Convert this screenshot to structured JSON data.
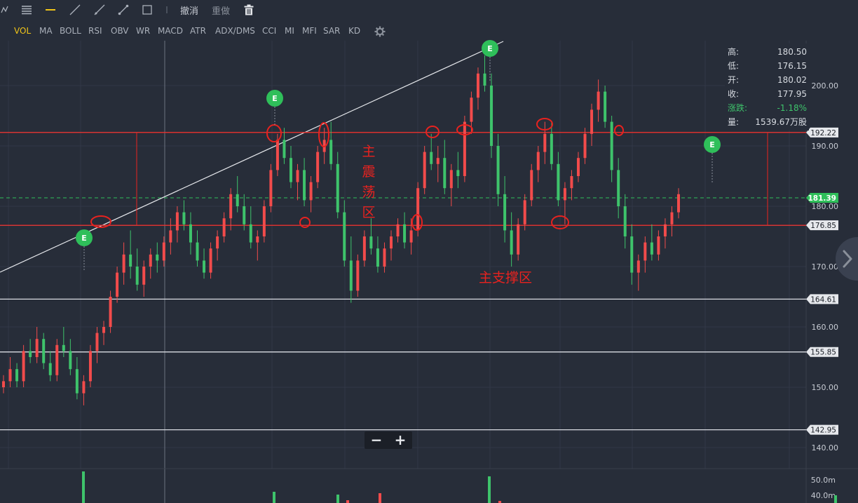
{
  "toolbar": {
    "undo_label": "撤消",
    "redo_label": "重做"
  },
  "indicators": [
    "VOL",
    "MA",
    "BOLL",
    "RSI",
    "OBV",
    "WR",
    "MACD",
    "ATR",
    "ADX/DMS",
    "CCI",
    "MI",
    "MFI",
    "SAR",
    "KD"
  ],
  "active_indicator": "VOL",
  "ohlc_panel": {
    "rows": [
      {
        "key": "高:",
        "value": "180.50"
      },
      {
        "key": "低:",
        "value": "176.15"
      },
      {
        "key": "开:",
        "value": "180.02"
      },
      {
        "key": "收:",
        "value": "177.95"
      },
      {
        "key": "涨跌:",
        "value": "-1.18%"
      },
      {
        "key": "量:",
        "value": "1539.67万股"
      }
    ],
    "change_color": "#3ec36b"
  },
  "zoom": {
    "minus": "−",
    "plus": "+"
  },
  "colors": {
    "background": "#272d39",
    "up": "#f24b4b",
    "down": "#3ec36b",
    "annotation": "#e8221f",
    "level_line": "#d9dce2",
    "current_price": "#2fbf5a"
  },
  "chart_data": {
    "type": "candlestick",
    "ylim": [
      135,
      208
    ],
    "y_ticks": [
      140,
      150,
      160,
      170,
      180,
      190,
      200
    ],
    "y_tick_labels": [
      "140.00",
      "150.00",
      "160.00",
      "170.00",
      "180.00",
      "190.00",
      "200.00"
    ],
    "horizontal_levels": [
      {
        "value": 192.22,
        "label": "192.22",
        "color": "#d9dce2"
      },
      {
        "value": 176.85,
        "label": "176.85",
        "color": "#d9dce2"
      },
      {
        "value": 164.61,
        "label": "164.61",
        "color": "#d9dce2"
      },
      {
        "value": 155.85,
        "label": "155.85",
        "color": "#d9dce2"
      },
      {
        "value": 142.95,
        "label": "142.95",
        "color": "#d9dce2"
      }
    ],
    "current_price": {
      "value": 181.39,
      "label": "181.39"
    },
    "candles": [
      [
        150,
        152,
        149,
        151
      ],
      [
        151,
        155,
        150,
        153
      ],
      [
        153,
        154,
        150,
        151
      ],
      [
        151,
        157,
        150,
        156
      ],
      [
        156,
        158,
        154,
        155
      ],
      [
        155,
        160,
        154,
        158
      ],
      [
        158,
        159,
        153,
        154
      ],
      [
        154,
        156,
        151,
        152
      ],
      [
        152,
        158,
        151,
        157
      ],
      [
        157,
        160,
        155,
        156
      ],
      [
        156,
        158,
        152,
        153
      ],
      [
        153,
        155,
        148,
        149
      ],
      [
        149,
        152,
        147,
        151
      ],
      [
        151,
        157,
        150,
        156
      ],
      [
        156,
        160,
        154,
        159
      ],
      [
        159,
        161,
        157,
        160
      ],
      [
        160,
        166,
        159,
        165
      ],
      [
        165,
        170,
        164,
        169
      ],
      [
        169,
        174,
        167,
        172
      ],
      [
        172,
        176,
        168,
        170
      ],
      [
        170,
        173,
        166,
        167
      ],
      [
        167,
        171,
        165,
        170
      ],
      [
        170,
        173,
        168,
        172
      ],
      [
        172,
        174,
        169,
        171
      ],
      [
        171,
        175,
        170,
        174
      ],
      [
        174,
        178,
        172,
        176
      ],
      [
        176,
        180,
        174,
        179
      ],
      [
        179,
        181,
        176,
        177
      ],
      [
        177,
        179,
        172,
        174
      ],
      [
        174,
        176,
        170,
        171
      ],
      [
        171,
        173,
        168,
        169
      ],
      [
        169,
        174,
        168,
        173
      ],
      [
        173,
        176,
        171,
        175
      ],
      [
        175,
        179,
        174,
        178
      ],
      [
        178,
        183,
        176,
        182
      ],
      [
        182,
        185,
        179,
        180
      ],
      [
        180,
        182,
        176,
        177
      ],
      [
        177,
        180,
        173,
        174
      ],
      [
        174,
        176,
        171,
        175
      ],
      [
        175,
        181,
        174,
        180
      ],
      [
        180,
        187,
        179,
        186
      ],
      [
        186,
        192,
        185,
        191
      ],
      [
        191,
        193,
        187,
        188
      ],
      [
        188,
        190,
        183,
        184
      ],
      [
        184,
        187,
        181,
        186
      ],
      [
        186,
        188,
        180,
        181
      ],
      [
        181,
        185,
        179,
        184
      ],
      [
        184,
        190,
        183,
        189
      ],
      [
        189,
        193,
        187,
        191
      ],
      [
        191,
        194,
        186,
        187
      ],
      [
        187,
        189,
        178,
        179
      ],
      [
        179,
        181,
        170,
        171
      ],
      [
        171,
        175,
        164,
        166
      ],
      [
        166,
        172,
        165,
        171
      ],
      [
        171,
        176,
        170,
        175
      ],
      [
        175,
        178,
        172,
        173
      ],
      [
        173,
        175,
        169,
        170
      ],
      [
        170,
        174,
        169,
        173
      ],
      [
        173,
        176,
        171,
        175
      ],
      [
        175,
        178,
        174,
        177
      ],
      [
        177,
        179,
        173,
        174
      ],
      [
        174,
        178,
        172,
        176
      ],
      [
        176,
        184,
        175,
        183
      ],
      [
        183,
        190,
        182,
        189
      ],
      [
        189,
        192,
        186,
        187
      ],
      [
        187,
        190,
        184,
        188
      ],
      [
        188,
        191,
        182,
        183
      ],
      [
        183,
        187,
        180,
        186
      ],
      [
        186,
        189,
        183,
        185
      ],
      [
        185,
        195,
        184,
        194
      ],
      [
        194,
        199,
        192,
        198
      ],
      [
        198,
        203,
        196,
        202
      ],
      [
        202,
        205,
        199,
        200
      ],
      [
        200,
        202,
        188,
        190
      ],
      [
        190,
        192,
        180,
        182
      ],
      [
        182,
        185,
        174,
        176
      ],
      [
        176,
        179,
        170,
        172
      ],
      [
        172,
        178,
        171,
        177
      ],
      [
        177,
        182,
        176,
        181
      ],
      [
        181,
        187,
        180,
        186
      ],
      [
        186,
        190,
        184,
        189
      ],
      [
        189,
        194,
        187,
        192
      ],
      [
        192,
        194,
        186,
        187
      ],
      [
        187,
        189,
        180,
        181
      ],
      [
        181,
        184,
        177,
        183
      ],
      [
        183,
        186,
        181,
        185
      ],
      [
        185,
        189,
        184,
        188
      ],
      [
        188,
        193,
        187,
        192
      ],
      [
        192,
        197,
        190,
        196
      ],
      [
        196,
        201,
        194,
        199
      ],
      [
        199,
        200,
        193,
        194
      ],
      [
        194,
        195,
        184,
        186
      ],
      [
        186,
        188,
        178,
        180
      ],
      [
        180,
        182,
        173,
        175
      ],
      [
        175,
        177,
        167,
        169
      ],
      [
        169,
        172,
        166,
        171
      ],
      [
        171,
        175,
        169,
        174
      ],
      [
        174,
        177,
        171,
        172
      ],
      [
        172,
        176,
        171,
        175
      ],
      [
        175,
        178,
        173,
        177
      ],
      [
        177,
        180,
        175,
        179
      ],
      [
        179,
        183,
        178,
        182
      ]
    ],
    "volume_ticks": [
      {
        "value": 50,
        "label": "50.0m"
      },
      {
        "value": 40,
        "label": "40.0m"
      }
    ],
    "volumes": [
      {
        "x": 119,
        "h": 45,
        "dir": "down"
      },
      {
        "x": 391,
        "h": 16,
        "dir": "down"
      },
      {
        "x": 482,
        "h": 12,
        "dir": "down"
      },
      {
        "x": 496,
        "h": 4,
        "dir": "up"
      },
      {
        "x": 542,
        "h": 14,
        "dir": "up"
      },
      {
        "x": 698,
        "h": 38,
        "dir": "down"
      },
      {
        "x": 713,
        "h": 3,
        "dir": "up"
      },
      {
        "x": 1192,
        "h": 11,
        "dir": "down"
      }
    ],
    "annotations": {
      "zone_label": "主\n震\n荡\n区",
      "support_label": "主支撑区",
      "event_marker": "E"
    }
  }
}
